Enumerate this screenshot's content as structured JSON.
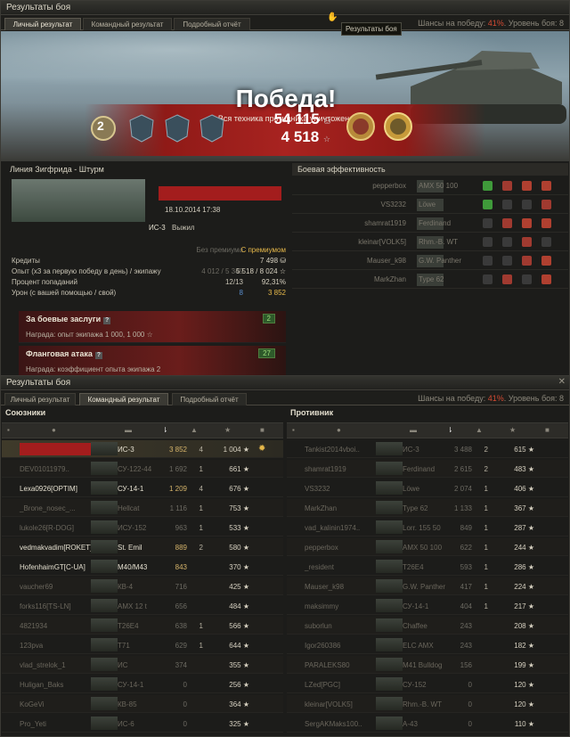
{
  "top": {
    "title": "Результаты боя",
    "tabs": [
      "Личный результат",
      "Командный результат",
      "Подробный отчёт"
    ],
    "active_tab": 0,
    "chance_label": "Шансы на победу:",
    "chance_value": "41%",
    "level_label": ". Уровень боя: 8",
    "tooltip": "Результаты боя",
    "victory": "Победа!",
    "subtitle": "Вся техника противника уничтожена",
    "rank_badge": "2",
    "credits": "54 115",
    "xp": "4 518",
    "map": "Линия Зигфрида - Штурм",
    "date": "18.10.2014 17:38",
    "vehicle": "ИС-3",
    "status": "Выжил",
    "col_without": "Без премиума",
    "col_with": "С премиумом",
    "stats": [
      {
        "label": "Кредиты",
        "a": "",
        "b": "7 498"
      },
      {
        "label": "Опыт (х3 за первую победу в день) / экипажу",
        "a": "4 012 / 5 349",
        "b": "5 518 / 8 024"
      },
      {
        "label": "Процент попаданий",
        "a": "12/13",
        "b": "92,31%"
      },
      {
        "label": "Урон (с вашей помощью / свой)",
        "a": "8",
        "b": "3 852"
      }
    ],
    "awards": [
      {
        "title": "За боевые заслуги",
        "num": "2",
        "reward": "Награда:  опыт экипажа 1 000, 1 000"
      },
      {
        "title": "Фланговая атака",
        "num": "27",
        "reward": "Награда:  коэффициент опыта экипажа 2"
      }
    ],
    "eff_title": "Боевая эффективность",
    "eff_rows": [
      {
        "player": "pepperbox",
        "vehicle": "AMX 50 100"
      },
      {
        "player": "VS3232",
        "vehicle": "Löwe"
      },
      {
        "player": "shamrat1919",
        "vehicle": "Ferdinand"
      },
      {
        "player": "kleinar[VOLK5]",
        "vehicle": "Rhm.-B. WT"
      },
      {
        "player": "Mauser_k98",
        "vehicle": "G.W. Panther"
      },
      {
        "player": "MarkZhan",
        "vehicle": "Type 62"
      }
    ]
  },
  "bottom": {
    "title": "Результаты боя",
    "tabs": [
      "Личный результат",
      "Командный результат",
      "Подробный отчёт"
    ],
    "active_tab": 1,
    "chance_label": "Шансы на победу:",
    "chance_value": "41%",
    "level_label": ". Уровень боя: 8",
    "allies_title": "Союзники",
    "enemies_title": "Противник",
    "allies": [
      {
        "name": "",
        "veh": "ИС-3",
        "dmg": "3 852",
        "kills": "4",
        "xp": "1 004",
        "alive": true,
        "me": true
      },
      {
        "name": "DEV01011979..",
        "veh": "СУ-122-44",
        "dmg": "1 692",
        "kills": "1",
        "xp": "661",
        "alive": false
      },
      {
        "name": "Lexa0926[OPTIM]",
        "veh": "СУ-14-1",
        "dmg": "1 209",
        "kills": "4",
        "xp": "676",
        "alive": true
      },
      {
        "name": "_Brone_nosec_...",
        "veh": "Hellcat",
        "dmg": "1 116",
        "kills": "1",
        "xp": "753",
        "alive": false
      },
      {
        "name": "lukole26[R-DOG]",
        "veh": "ИСУ-152",
        "dmg": "963",
        "kills": "1",
        "xp": "533",
        "alive": false
      },
      {
        "name": "vedmakvadim[ROKET]",
        "veh": "St. Emil",
        "dmg": "889",
        "kills": "2",
        "xp": "580",
        "alive": true
      },
      {
        "name": "HofenhaimGT[C-UA]",
        "veh": "M40/M43",
        "dmg": "843",
        "kills": "",
        "xp": "370",
        "alive": true
      },
      {
        "name": "vaucher69",
        "veh": "КВ-4",
        "dmg": "716",
        "kills": "",
        "xp": "425",
        "alive": false
      },
      {
        "name": "forks116[TS-LN]",
        "veh": "AMX 12 t",
        "dmg": "656",
        "kills": "",
        "xp": "484",
        "alive": false
      },
      {
        "name": "4821934",
        "veh": "T26E4",
        "dmg": "638",
        "kills": "1",
        "xp": "566",
        "alive": false
      },
      {
        "name": "123pva",
        "veh": "T71",
        "dmg": "629",
        "kills": "1",
        "xp": "644",
        "alive": false
      },
      {
        "name": "vlad_strelok_1",
        "veh": "ИС",
        "dmg": "374",
        "kills": "",
        "xp": "355",
        "alive": false
      },
      {
        "name": "Huligan_Baks",
        "veh": "СУ-14-1",
        "dmg": "0",
        "kills": "",
        "xp": "256",
        "alive": false
      },
      {
        "name": "KoGeVi",
        "veh": "КВ-85",
        "dmg": "0",
        "kills": "",
        "xp": "364",
        "alive": false
      },
      {
        "name": "Pro_Yeti",
        "veh": "ИС-6",
        "dmg": "0",
        "kills": "",
        "xp": "325",
        "alive": false
      }
    ],
    "enemies": [
      {
        "name": "Tankist2014vboi..",
        "veh": "ИС-3",
        "dmg": "3 488",
        "kills": "2",
        "xp": "615"
      },
      {
        "name": "shamrat1919",
        "veh": "Ferdinand",
        "dmg": "2 615",
        "kills": "2",
        "xp": "483"
      },
      {
        "name": "VS3232",
        "veh": "Löwe",
        "dmg": "2 074",
        "kills": "1",
        "xp": "406"
      },
      {
        "name": "MarkZhan",
        "veh": "Type 62",
        "dmg": "1 133",
        "kills": "1",
        "xp": "367"
      },
      {
        "name": "vad_kalinin1974..",
        "veh": "Lorr. 155 50",
        "dmg": "849",
        "kills": "1",
        "xp": "287"
      },
      {
        "name": "pepperbox",
        "veh": "AMX 50 100",
        "dmg": "622",
        "kills": "1",
        "xp": "244"
      },
      {
        "name": "_resident",
        "veh": "T26E4",
        "dmg": "593",
        "kills": "1",
        "xp": "286"
      },
      {
        "name": "Mauser_k98",
        "veh": "G.W. Panther",
        "dmg": "417",
        "kills": "1",
        "xp": "224"
      },
      {
        "name": "maksimmy",
        "veh": "СУ-14-1",
        "dmg": "404",
        "kills": "1",
        "xp": "217"
      },
      {
        "name": "suborlun",
        "veh": "Chaffee",
        "dmg": "243",
        "kills": "",
        "xp": "208"
      },
      {
        "name": "Igor260386",
        "veh": "ELC AMX",
        "dmg": "243",
        "kills": "",
        "xp": "182"
      },
      {
        "name": "PARALEKS80",
        "veh": "M41 Bulldog",
        "dmg": "156",
        "kills": "",
        "xp": "199"
      },
      {
        "name": "LZed[PGC]",
        "veh": "СУ-152",
        "dmg": "0",
        "kills": "",
        "xp": "120"
      },
      {
        "name": "kleinar[VOLK5]",
        "veh": "Rhm.-B. WT",
        "dmg": "0",
        "kills": "",
        "xp": "120"
      },
      {
        "name": "SergAKMaks100..",
        "veh": "A-43",
        "dmg": "0",
        "kills": "",
        "xp": "110"
      }
    ]
  }
}
